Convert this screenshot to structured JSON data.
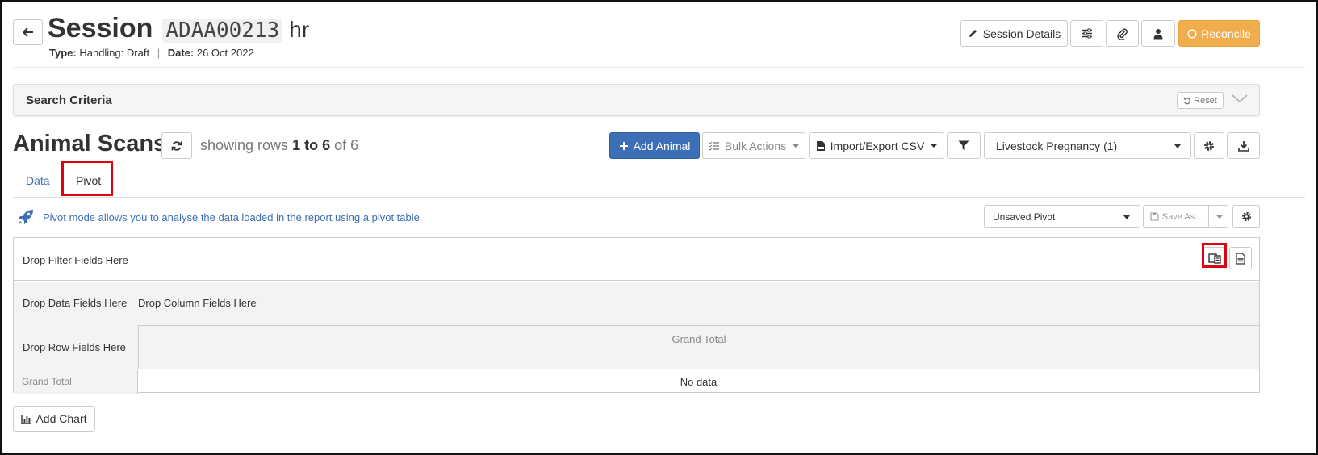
{
  "header": {
    "title": "Session",
    "code": "ADAA00213",
    "suffix": "hr",
    "type_label": "Type:",
    "type_value": "Handling: Draft",
    "separator": "|",
    "date_label": "Date:",
    "date_value": "26 Oct 2022",
    "session_details_label": "Session Details",
    "reconcile_label": "Reconcile"
  },
  "search_criteria": {
    "title": "Search Criteria",
    "reset_label": "Reset"
  },
  "scans": {
    "title": "Animal Scans",
    "showing_prefix": "showing rows",
    "showing_range": "1 to 6",
    "showing_of": "of 6",
    "add_animal_label": "Add Animal",
    "bulk_actions_label": "Bulk Actions",
    "import_export_label": "Import/Export CSV",
    "report_select_value": "Livestock Pregnancy (1)"
  },
  "tabs": [
    {
      "label": "Data"
    },
    {
      "label": "Pivot"
    }
  ],
  "pivot": {
    "info_text": "Pivot mode allows you to analyse the data loaded in the report using a pivot table.",
    "pivot_select_value": "Unsaved Pivot",
    "save_as_label": "Save As...",
    "filter_zone": "Drop Filter Fields Here",
    "data_zone": "Drop Data Fields Here",
    "column_zone": "Drop Column Fields Here",
    "row_zone": "Drop Row Fields Here",
    "grand_total_header": "Grand Total",
    "grand_total_row": "Grand Total",
    "no_data": "No data"
  },
  "add_chart_label": "Add Chart",
  "colors": {
    "primary": "#3d6fb6",
    "warning": "#f0ad4e",
    "highlight": "#e0000f"
  }
}
